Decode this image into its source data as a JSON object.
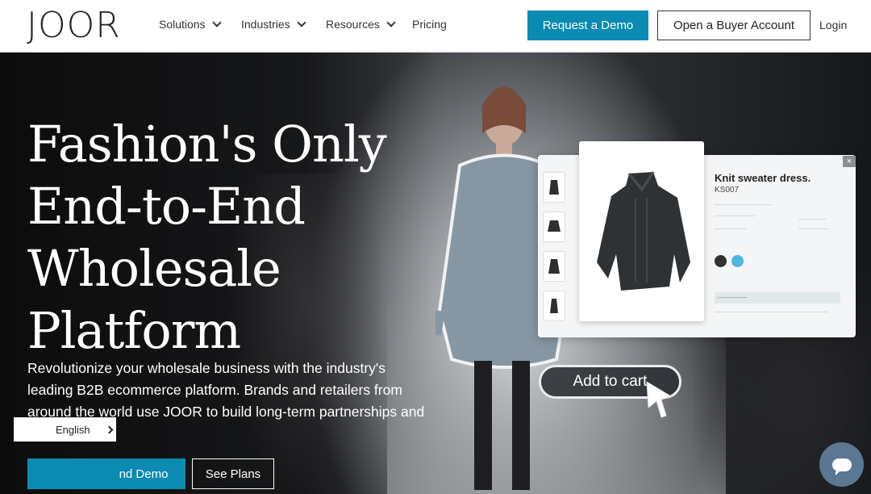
{
  "nav": {
    "logo": "JOOR",
    "menu": [
      {
        "label": "Solutions",
        "has_dropdown": true
      },
      {
        "label": "Industries",
        "has_dropdown": true
      },
      {
        "label": "Resources",
        "has_dropdown": true
      },
      {
        "label": "Pricing",
        "has_dropdown": false
      }
    ],
    "demo_label": "Request a Demo",
    "buyer_label": "Open a Buyer Account",
    "login_label": "Login"
  },
  "hero": {
    "headline": "Fashion's Only End-to-End Wholesale Platform",
    "subtext": "Revolutionize your wholesale business with the industry's leading B2B ecommerce platform. Brands and retailers from around the world use JOOR to build long-term partnerships and drive growth.",
    "cta_demo_label": "nd Demo",
    "cta_plans_label": "See Plans"
  },
  "product_card": {
    "name": "Knit sweater dress.",
    "sku": "KS007",
    "swatch_colors": [
      "#2f3133",
      "#4fb6e0"
    ],
    "add_to_cart_label": "Add to cart",
    "close_icon": "×"
  },
  "language": {
    "label": "English"
  },
  "colors": {
    "accent": "#0b8ab2",
    "chat": "#5b7793"
  }
}
